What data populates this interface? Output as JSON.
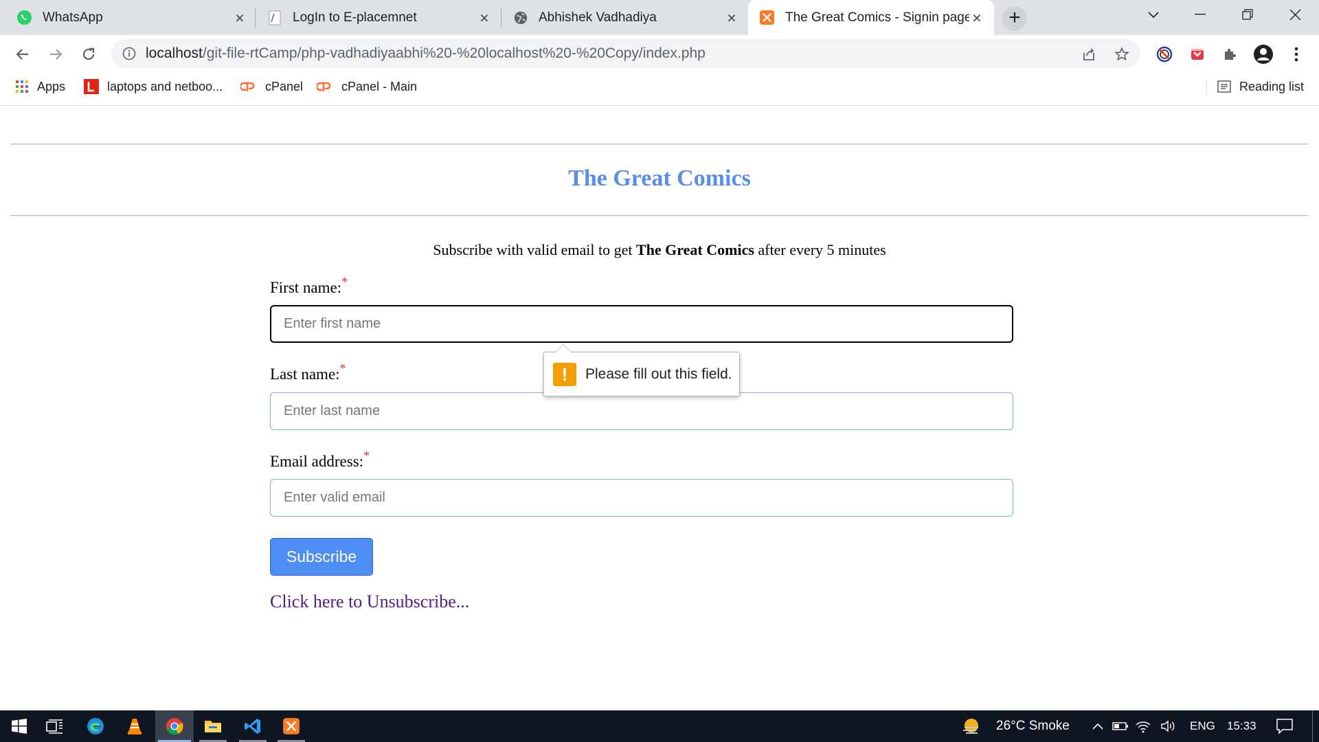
{
  "browser": {
    "tabs": [
      {
        "title": "WhatsApp",
        "icon": "whatsapp-icon"
      },
      {
        "title": "LogIn to E-placemnet",
        "icon": "page-icon"
      },
      {
        "title": "Abhishek Vadhadiya",
        "icon": "globe-icon"
      },
      {
        "title": "The Great Comics - Signin page",
        "icon": "xampp-icon",
        "active": true
      }
    ],
    "url_host": "localhost",
    "url_path": "/git-file-rtCamp/php-vadhadiyaabhi%20-%20localhost%20-%20Copy/index.php",
    "bookmarks": [
      {
        "label": "Apps",
        "icon": "apps-grid-icon"
      },
      {
        "label": "laptops and netboo...",
        "icon": "lenovo-icon"
      },
      {
        "label": "cPanel",
        "icon": "cpanel-icon"
      },
      {
        "label": "cPanel - Main",
        "icon": "cpanel-icon"
      }
    ],
    "reading_list": "Reading list"
  },
  "page": {
    "title": "The Great Comics",
    "intro_before": "Subscribe with valid email to get ",
    "intro_bold": "The Great Comics",
    "intro_after": " after every 5 minutes",
    "first_name_label": "First name:",
    "first_name_placeholder": "Enter first name",
    "last_name_label": "Last name:",
    "last_name_placeholder": "Enter last name",
    "email_label": "Email address:",
    "email_placeholder": "Enter valid email",
    "required_mark": "*",
    "subscribe_label": "Subscribe",
    "unsubscribe_link": "Click here to Unsubscribe...",
    "validation_message": "Please fill out this field.",
    "validation_icon": "!"
  },
  "taskbar": {
    "weather": "26°C  Smoke",
    "language": "ENG",
    "time": "15:33"
  },
  "colors": {
    "title": "#5a8ee6",
    "button": "#4d8ef5",
    "link_visited": "#551a8b",
    "required": "#e03030",
    "warning": "#f5a000"
  }
}
